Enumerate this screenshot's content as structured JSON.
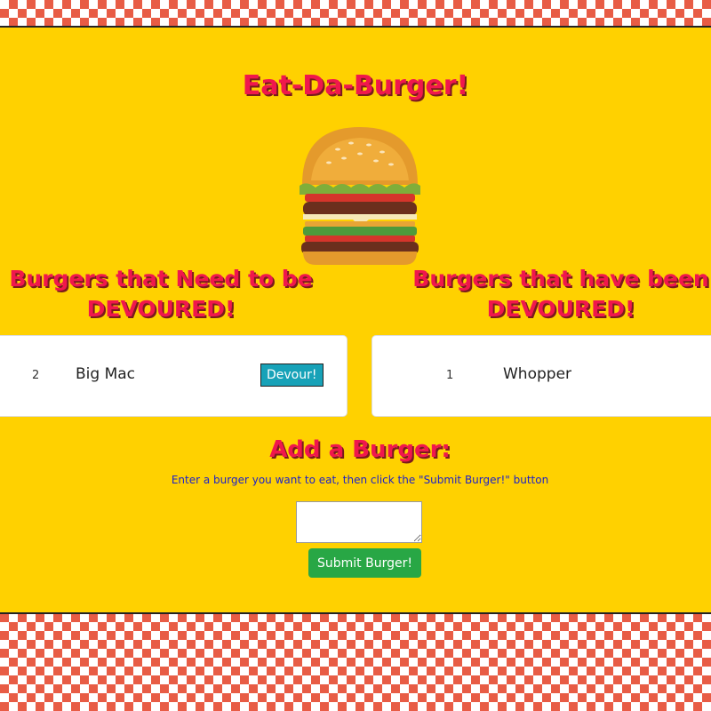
{
  "page": {
    "title": "Eat-Da-Burger!"
  },
  "columns": {
    "left_heading": "Burgers that Need to be DEVOURED!",
    "right_heading": "Burgers that have been DEVOURED!"
  },
  "uneaten": [
    {
      "id": "2",
      "name": "Big Mac",
      "button_label": "Devour!"
    }
  ],
  "devoured": [
    {
      "id": "1",
      "name": "Whopper"
    }
  ],
  "form": {
    "heading": "Add a Burger:",
    "instructions": "Enter a burger you want to eat, then click the \"Submit Burger!\" button",
    "input_value": "",
    "submit_label": "Submit Burger!"
  },
  "colors": {
    "background": "#ffd100",
    "heading": "#f0174d",
    "checker": "#e85c45",
    "devour_button": "#17a2b8",
    "submit_button": "#28a745",
    "instructions": "#1d22c9"
  },
  "icons": {
    "hero": "burger-icon"
  }
}
